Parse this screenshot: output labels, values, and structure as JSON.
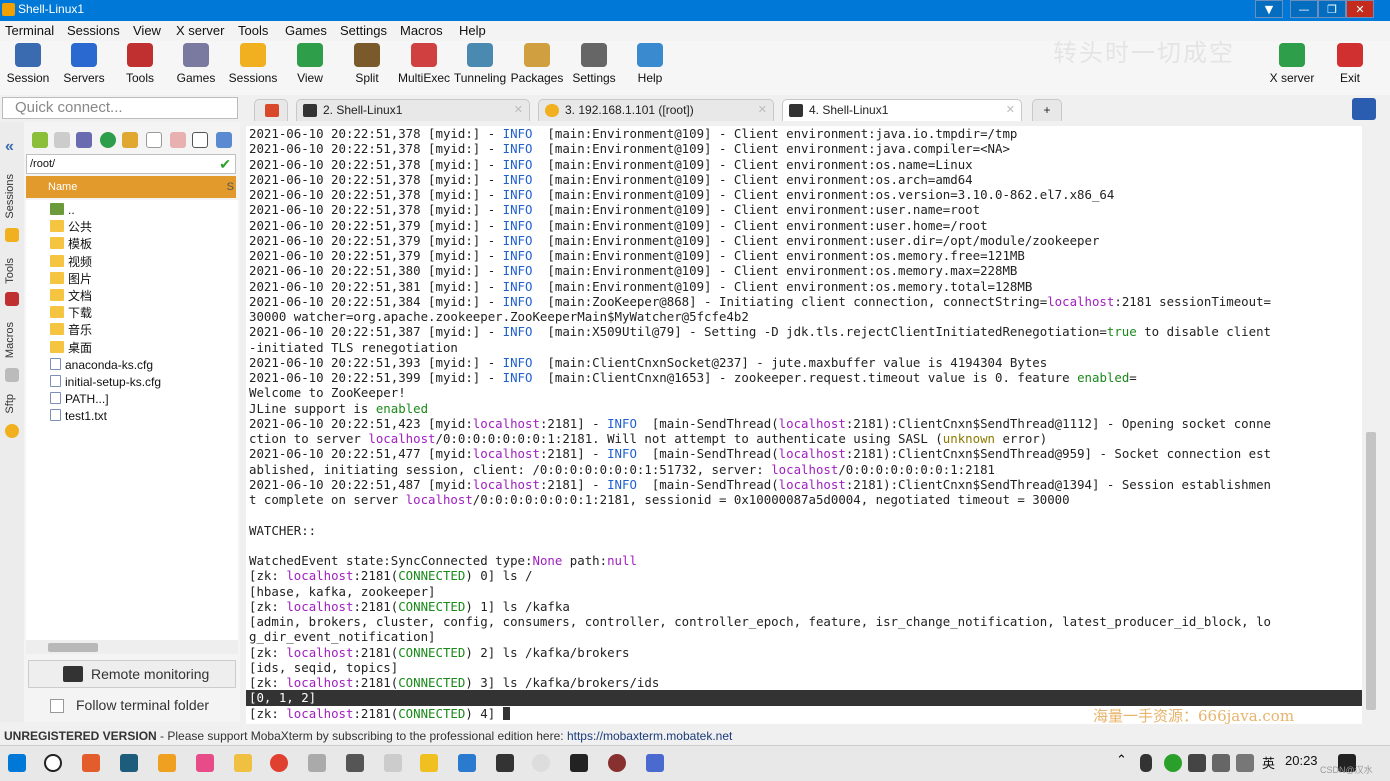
{
  "window": {
    "title": "Shell-Linux1",
    "min": "—",
    "max": "❐",
    "close": "✕"
  },
  "menu": [
    "Terminal",
    "Sessions",
    "View",
    "X server",
    "Tools",
    "Games",
    "Settings",
    "Macros",
    "Help"
  ],
  "toolbar": [
    "Session",
    "Servers",
    "Tools",
    "Games",
    "Sessions",
    "View",
    "Split",
    "MultiExec",
    "Tunneling",
    "Packages",
    "Settings",
    "Help"
  ],
  "toolbar_right": [
    "X server",
    "Exit"
  ],
  "overlay_text": "转头时一切成空",
  "quick_connect": {
    "placeholder": "Quick connect..."
  },
  "tabs": [
    {
      "label": "2. Shell-Linux1",
      "close": "✕"
    },
    {
      "label": "3. 192.168.1.101 ([root])",
      "close": "✕"
    },
    {
      "label": "4. Shell-Linux1",
      "close": "✕"
    }
  ],
  "side_tabs": [
    "Sessions",
    "Tools",
    "Macros",
    "Sftp"
  ],
  "sftp": {
    "path": "/root/",
    "column": "Name",
    "column2": "S",
    "files": [
      {
        "name": "..",
        "type": "up"
      },
      {
        "name": "公共",
        "type": "folder"
      },
      {
        "name": "模板",
        "type": "folder"
      },
      {
        "name": "视频",
        "type": "folder"
      },
      {
        "name": "图片",
        "type": "folder"
      },
      {
        "name": "文档",
        "type": "folder"
      },
      {
        "name": "下载",
        "type": "folder"
      },
      {
        "name": "音乐",
        "type": "folder"
      },
      {
        "name": "桌面",
        "type": "folder"
      },
      {
        "name": "anaconda-ks.cfg",
        "type": "file"
      },
      {
        "name": "initial-setup-ks.cfg",
        "type": "file"
      },
      {
        "name": "PATH...]",
        "type": "file"
      },
      {
        "name": "test1.txt",
        "type": "file"
      }
    ],
    "remote_monitoring": "Remote monitoring",
    "follow_folder": "Follow terminal folder"
  },
  "terminal_lines": [
    "2021-06-10 20:22:51,378 [myid:] - INFO  [main:Environment@109] - Client environment:java.io.tmpdir=/tmp",
    "2021-06-10 20:22:51,378 [myid:] - INFO  [main:Environment@109] - Client environment:java.compiler=<NA>",
    "2021-06-10 20:22:51,378 [myid:] - INFO  [main:Environment@109] - Client environment:os.name=Linux",
    "2021-06-10 20:22:51,378 [myid:] - INFO  [main:Environment@109] - Client environment:os.arch=amd64",
    "2021-06-10 20:22:51,378 [myid:] - INFO  [main:Environment@109] - Client environment:os.version=3.10.0-862.el7.x86_64",
    "2021-06-10 20:22:51,378 [myid:] - INFO  [main:Environment@109] - Client environment:user.name=root",
    "2021-06-10 20:22:51,379 [myid:] - INFO  [main:Environment@109] - Client environment:user.home=/root",
    "2021-06-10 20:22:51,379 [myid:] - INFO  [main:Environment@109] - Client environment:user.dir=/opt/module/zookeeper",
    "2021-06-10 20:22:51,379 [myid:] - INFO  [main:Environment@109] - Client environment:os.memory.free=121MB",
    "2021-06-10 20:22:51,380 [myid:] - INFO  [main:Environment@109] - Client environment:os.memory.max=228MB",
    "2021-06-10 20:22:51,381 [myid:] - INFO  [main:Environment@109] - Client environment:os.memory.total=128MB",
    "2021-06-10 20:22:51,384 [myid:] - INFO  [main:ZooKeeper@868] - Initiating client connection, connectString=localhost:2181 sessionTimeout=",
    "30000 watcher=org.apache.zookeeper.ZooKeeperMain$MyWatcher@5fcfe4b2",
    "2021-06-10 20:22:51,387 [myid:] - INFO  [main:X509Util@79] - Setting -D jdk.tls.rejectClientInitiatedRenegotiation=true to disable client",
    "-initiated TLS renegotiation",
    "2021-06-10 20:22:51,393 [myid:] - INFO  [main:ClientCnxnSocket@237] - jute.maxbuffer value is 4194304 Bytes",
    "2021-06-10 20:22:51,399 [myid:] - INFO  [main:ClientCnxn@1653] - zookeeper.request.timeout value is 0. feature enabled=",
    "Welcome to ZooKeeper!",
    "JLine support is enabled",
    "2021-06-10 20:22:51,423 [myid:localhost:2181] - INFO  [main-SendThread(localhost:2181):ClientCnxn$SendThread@1112] - Opening socket conne",
    "ction to server localhost/0:0:0:0:0:0:0:1:2181. Will not attempt to authenticate using SASL (unknown error)",
    "2021-06-10 20:22:51,477 [myid:localhost:2181] - INFO  [main-SendThread(localhost:2181):ClientCnxn$SendThread@959] - Socket connection est",
    "ablished, initiating session, client: /0:0:0:0:0:0:0:1:51732, server: localhost/0:0:0:0:0:0:0:1:2181",
    "2021-06-10 20:22:51,487 [myid:localhost:2181] - INFO  [main-SendThread(localhost:2181):ClientCnxn$SendThread@1394] - Session establishmen",
    "t complete on server localhost/0:0:0:0:0:0:0:1:2181, sessionid = 0x10000087a5d0004, negotiated timeout = 30000",
    "",
    "WATCHER::",
    "",
    "WatchedEvent state:SyncConnected type:None path:null",
    "[zk: localhost:2181(CONNECTED) 0] ls /",
    "[hbase, kafka, zookeeper]",
    "[zk: localhost:2181(CONNECTED) 1] ls /kafka",
    "[admin, brokers, cluster, config, consumers, controller, controller_epoch, feature, isr_change_notification, latest_producer_id_block, lo",
    "g_dir_event_notification]",
    "[zk: localhost:2181(CONNECTED) 2] ls /kafka/brokers",
    "[ids, seqid, topics]",
    "[zk: localhost:2181(CONNECTED) 3] ls /kafka/brokers/ids",
    "[0, 1, 2]",
    "[zk: localhost:2181(CONNECTED) 4] "
  ],
  "selected_line": 37,
  "watermark": "海量一手资源：666java.com",
  "status": {
    "label": "UNREGISTERED VERSION",
    "message": " -  Please support MobaXterm by subscribing to the professional edition here:",
    "link": "https://mobaxterm.mobatek.net"
  },
  "taskbar": {
    "lang": "英",
    "clock": "20:23",
    "csdn": "CSDN@汉水"
  }
}
